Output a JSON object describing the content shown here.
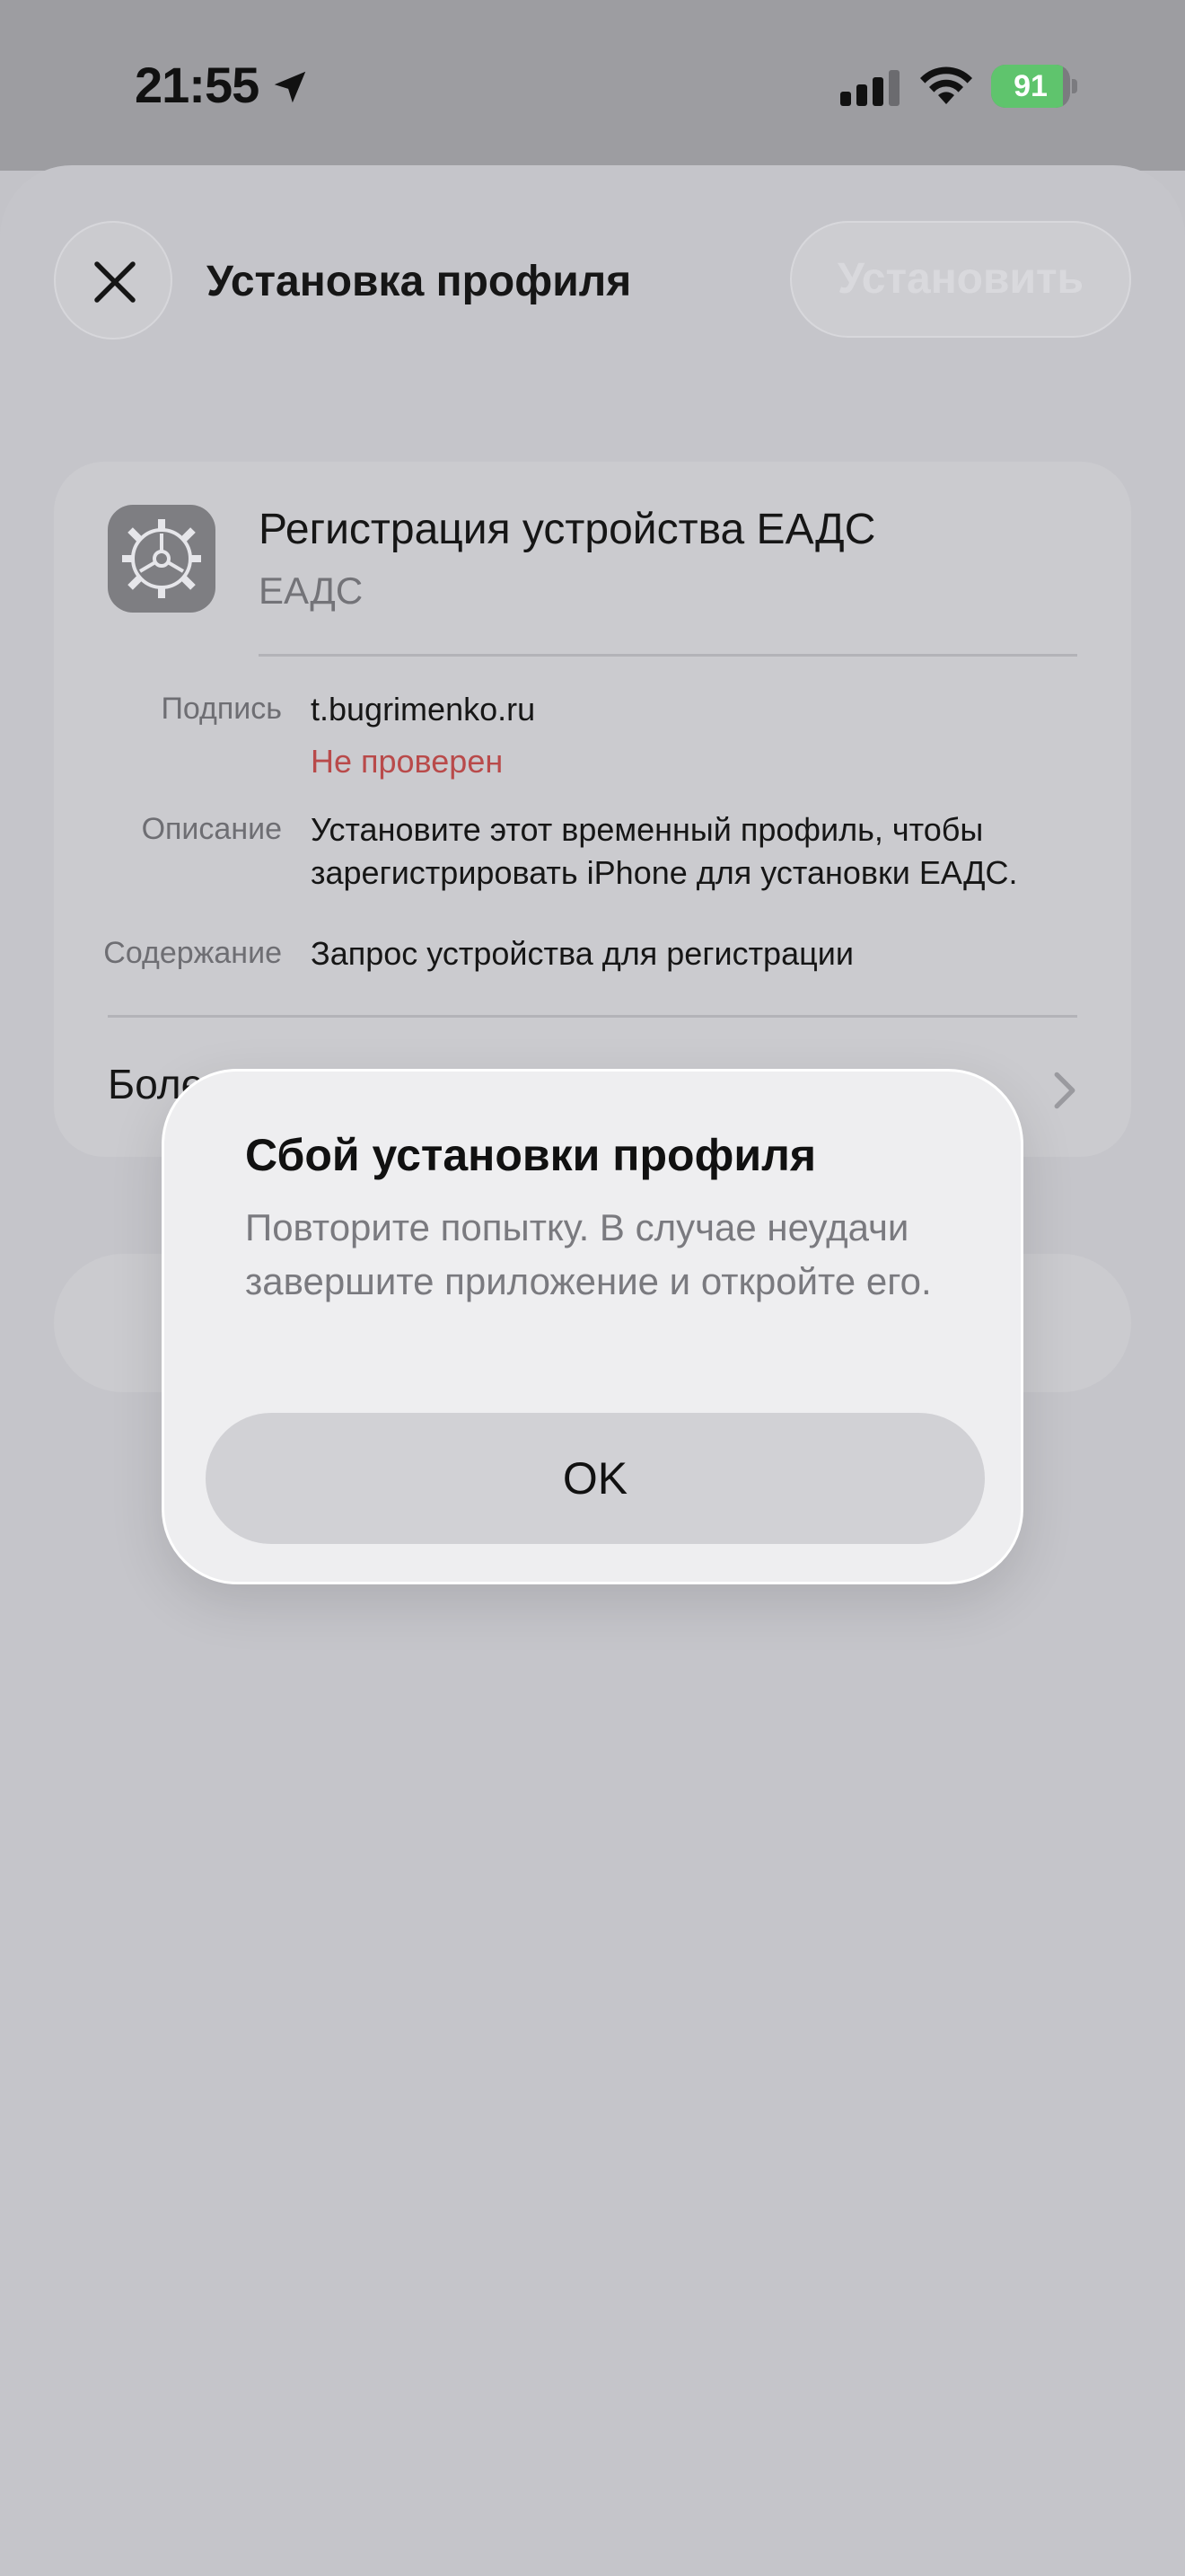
{
  "status_bar": {
    "time": "21:55",
    "battery": "91",
    "battery_level_percent": 91,
    "battery_color": "#5fc46d"
  },
  "header": {
    "title": "Установка профиля",
    "install_label": "Установить",
    "close_icon": "close-icon"
  },
  "profile": {
    "name": "Регистрация устройства ЕАДС",
    "org": "ЕАДС",
    "icon": "gear-icon"
  },
  "details": {
    "signed_label": "Подпись",
    "signed_value": "t.bugrimenko.ru",
    "signed_status": "Не проверен",
    "description_label": "Описание",
    "description_value": "Установите этот временный профиль, чтобы зарегистрировать iPhone для установки ЕАДС.",
    "contents_label": "Содержание",
    "contents_value": "Запрос устройства для регистрации",
    "more_label": "Боле"
  },
  "alert": {
    "title": "Сбой установки профиля",
    "message": "Повторите попытку. В случае неудачи завершите приложение и откройте его.",
    "ok_label": "OK"
  },
  "colors": {
    "unverified": "#b94a4a",
    "overlay": "#c3c3c8"
  }
}
